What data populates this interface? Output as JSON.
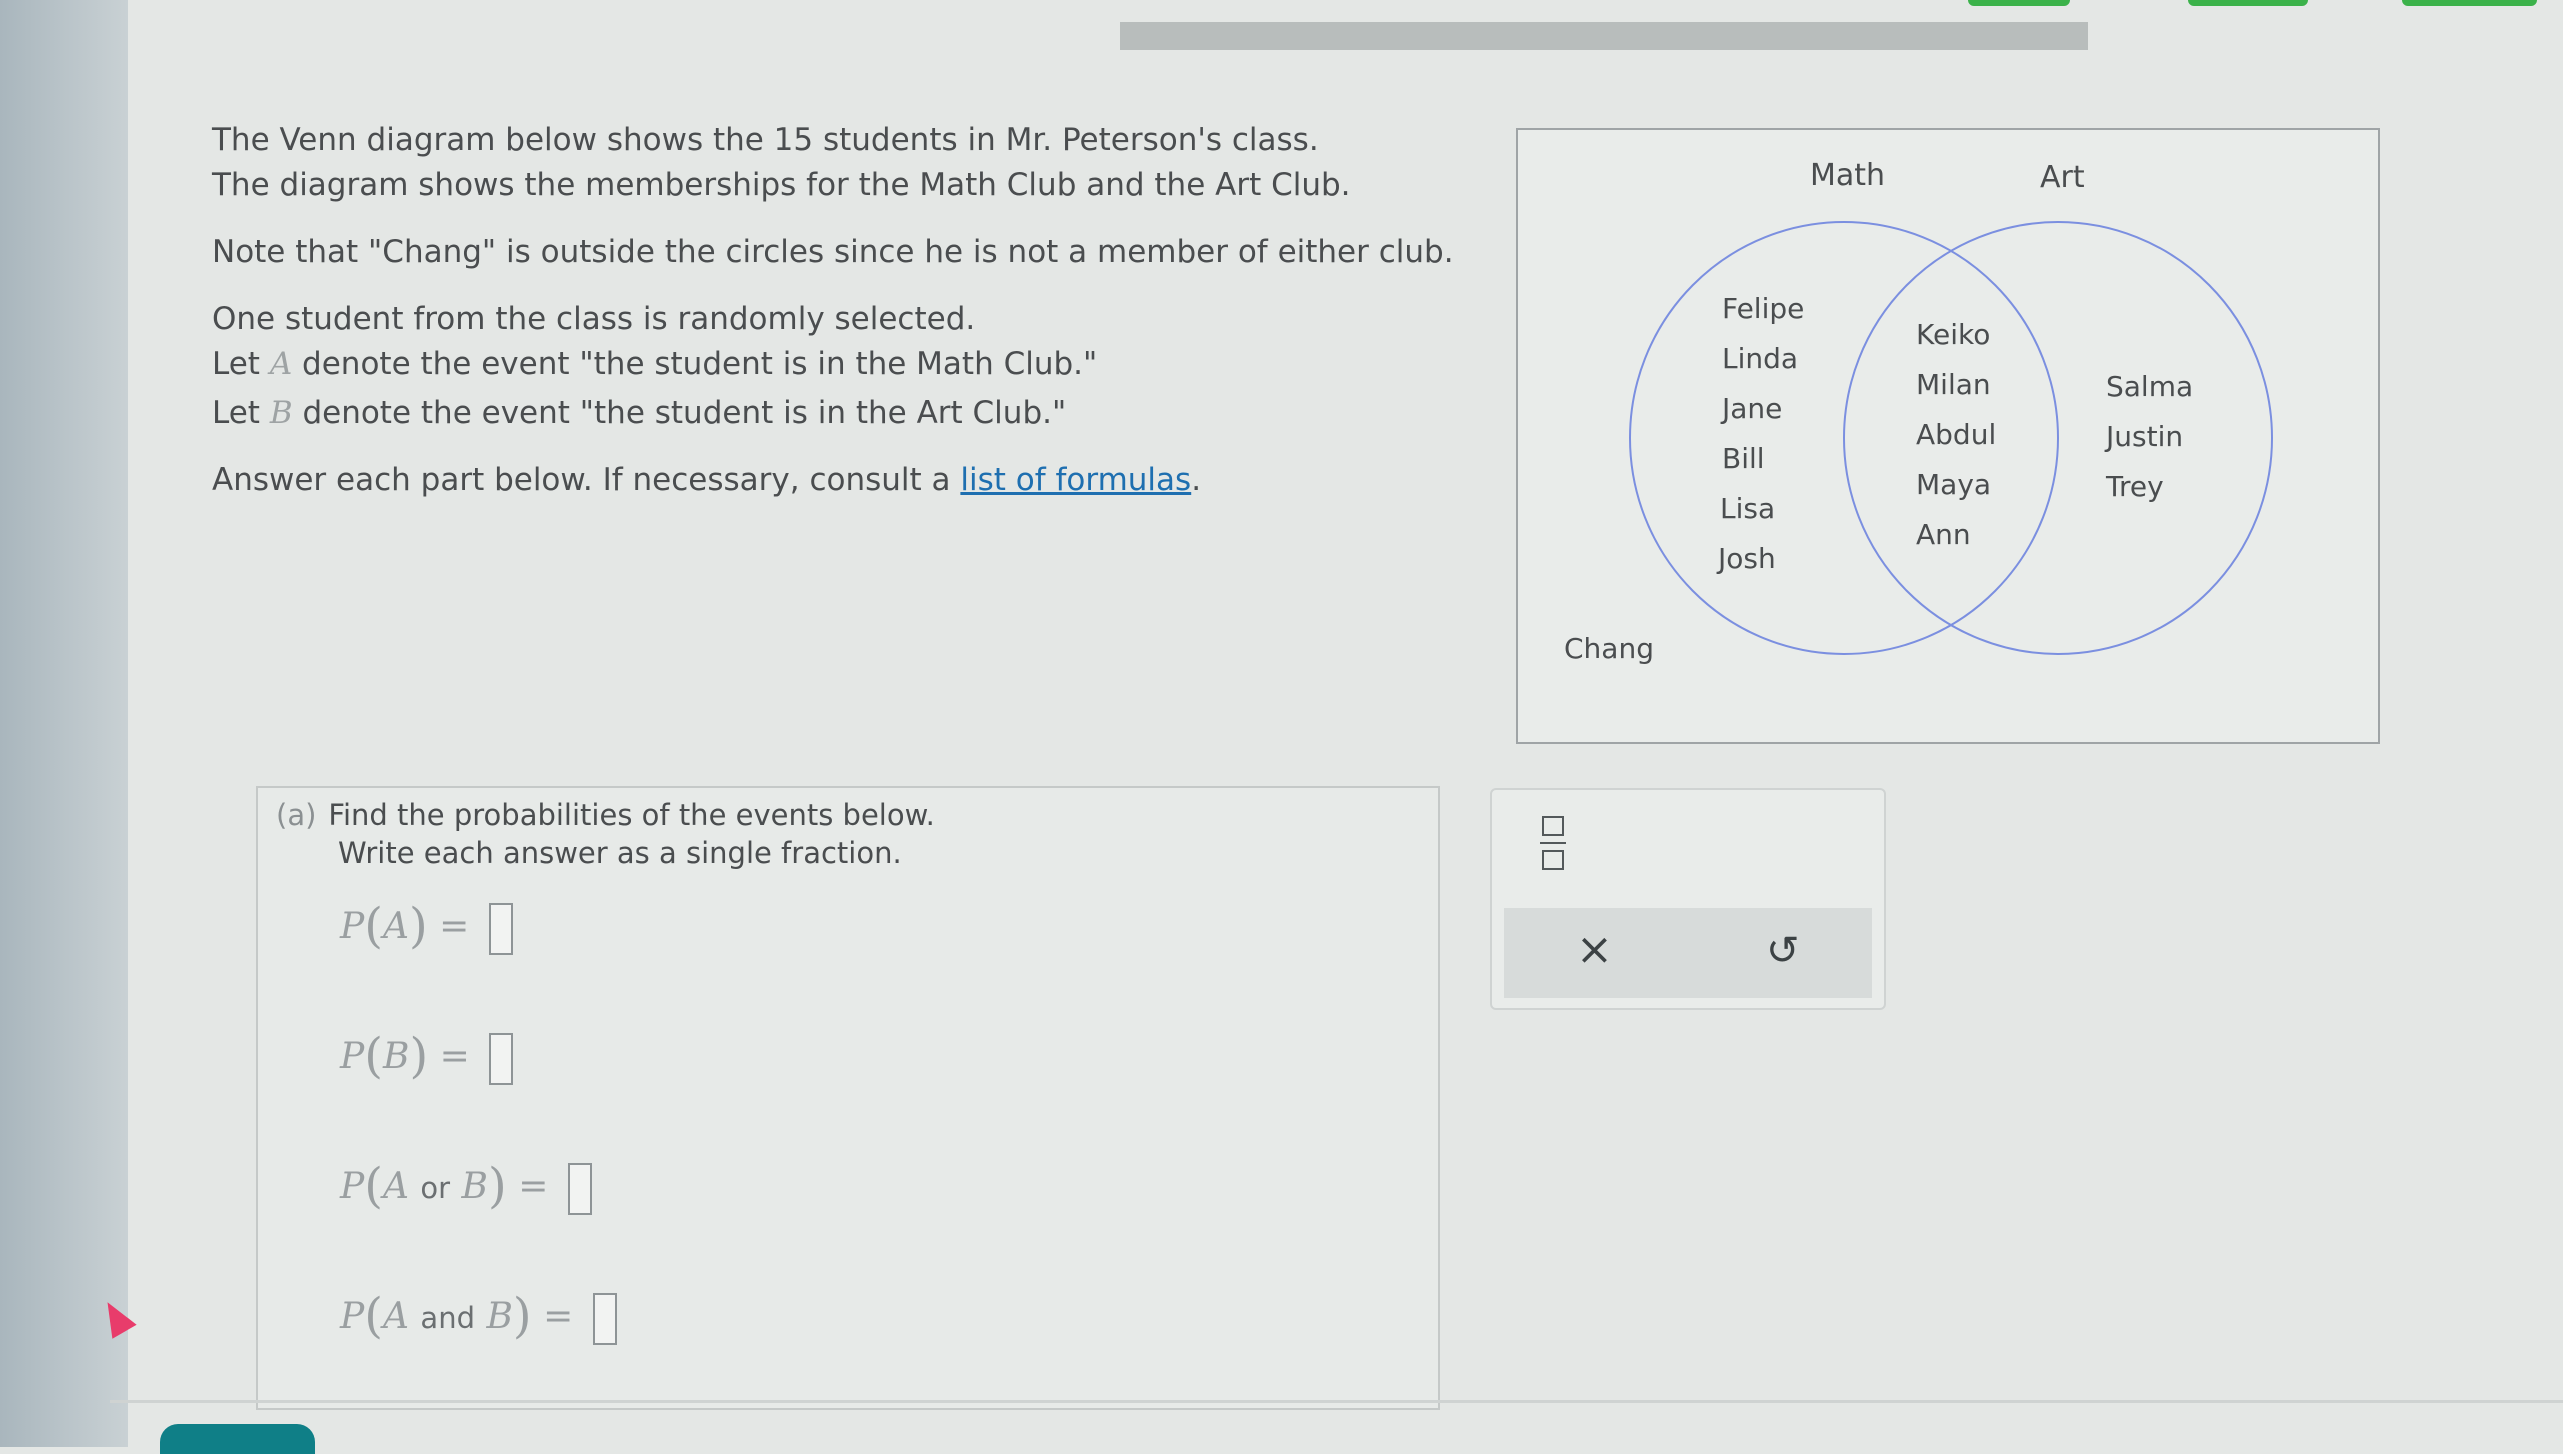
{
  "intro": {
    "line1": "The Venn diagram below shows the 15 students in Mr. Peterson's class.",
    "line2": "The diagram shows the memberships for the Math Club and the Art Club.",
    "note": "Note that \"Chang\" is outside the circles since he is not a member of either club.",
    "select": "One student from the class is randomly selected.",
    "letA_pre": "Let ",
    "varA": "A",
    "letA_post": " denote the event \"the student is in the Math Club.\"",
    "letB_pre": "Let ",
    "varB": "B",
    "letB_post": " denote the event \"the student is in the Art Club.\"",
    "answer_pre": "Answer each part below. If necessary, consult a ",
    "link": "list of formulas",
    "answer_post": "."
  },
  "venn": {
    "math_label": "Math",
    "art_label": "Art",
    "math_only": [
      "Felipe",
      "Linda",
      "Jane",
      "Bill",
      "Lisa",
      "Josh"
    ],
    "both": [
      "Keiko",
      "Milan",
      "Abdul",
      "Maya",
      "Ann"
    ],
    "art_only": [
      "Salma",
      "Justin",
      "Trey"
    ],
    "outside": "Chang",
    "circle_color": "#7b8fe0"
  },
  "part_a": {
    "letter": "(a)",
    "line1": "Find the probabilities of the events below.",
    "line2": "Write each answer as a single fraction.",
    "eq1": {
      "p": "P",
      "arg": "A",
      "eq": "="
    },
    "eq2": {
      "p": "P",
      "arg": "B",
      "eq": "="
    },
    "eq3": {
      "p": "P",
      "arg1": "A",
      "word": "or",
      "arg2": "B",
      "eq": "="
    },
    "eq4": {
      "p": "P",
      "arg1": "A",
      "word": "and",
      "arg2": "B",
      "eq": "="
    }
  },
  "tools": {
    "clear": "×",
    "undo": "↺"
  },
  "colors": {
    "link": "#1e6fb0",
    "accent_green": "#3bb24a",
    "teal_tab": "#0f7f87"
  }
}
